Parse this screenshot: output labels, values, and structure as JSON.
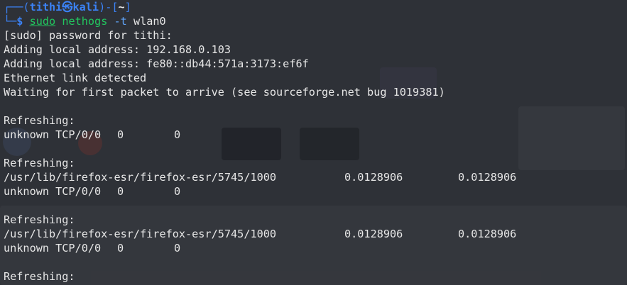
{
  "colors": {
    "background": "#2e3137",
    "text": "#e6e6e6",
    "prompt": "#3b82f6",
    "command": "#22c55e"
  },
  "prompt": {
    "top_open": "┌──(",
    "user": "tithi",
    "at_icon": "㉿",
    "host": "kali",
    "top_mid": ")-[",
    "dir": "~",
    "top_close": "]",
    "bottom": "└─",
    "dollar": "$"
  },
  "command": {
    "sudo": "sudo",
    "name": "nethogs",
    "flag": "-t",
    "arg": "wlan0"
  },
  "output": {
    "l1": "[sudo] password for tithi:",
    "l2": "Adding local address: 192.168.0.103",
    "l3": "Adding local address: fe80::db44:571a:3173:ef6f",
    "l4": "Ethernet link detected",
    "l5": "Waiting for first packet to arrive (see sourceforge.net bug 1019381)"
  },
  "blocks": [
    {
      "header": "Refreshing:",
      "rows": [
        {
          "program": "unknown TCP/0/0",
          "sent": "0",
          "received": "0"
        }
      ]
    },
    {
      "header": "Refreshing:",
      "rows": [
        {
          "program": "/usr/lib/firefox-esr/firefox-esr/5745/1000",
          "sent": "0.0128906",
          "received": "0.0128906"
        },
        {
          "program": "unknown TCP/0/0",
          "sent": "0",
          "received": "0"
        }
      ]
    },
    {
      "header": "Refreshing:",
      "rows": [
        {
          "program": "/usr/lib/firefox-esr/firefox-esr/5745/1000",
          "sent": "0.0128906",
          "received": "0.0128906"
        },
        {
          "program": "unknown TCP/0/0",
          "sent": "0",
          "received": "0"
        }
      ]
    }
  ],
  "trailing": "Refreshing:"
}
